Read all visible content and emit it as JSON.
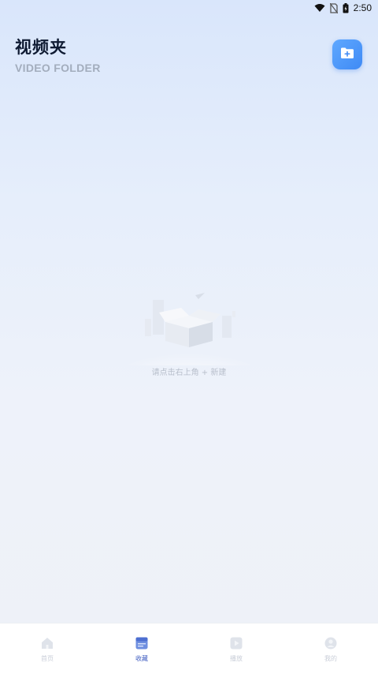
{
  "status_bar": {
    "time": "2:50",
    "icons": [
      "wifi-icon",
      "no-sim-icon",
      "battery-icon"
    ]
  },
  "header": {
    "title": "视频夹",
    "subtitle": "VIDEO FOLDER",
    "add_button_icon": "folder-add-icon"
  },
  "empty_state": {
    "illustration": "empty-box-icon",
    "hint": "请点击右上角 + 新建"
  },
  "tabbar": {
    "tabs": [
      {
        "label": "首页",
        "icon": "home-icon",
        "active": false
      },
      {
        "label": "收藏",
        "icon": "favorite-icon",
        "active": true
      },
      {
        "label": "播放",
        "icon": "play-icon",
        "active": false
      },
      {
        "label": "我的",
        "icon": "profile-icon",
        "active": false
      }
    ]
  },
  "colors": {
    "accent": "#3f8af5",
    "active_tab": "#3e5cc0",
    "title": "#0f1b33",
    "subtitle": "#a3adbd"
  }
}
